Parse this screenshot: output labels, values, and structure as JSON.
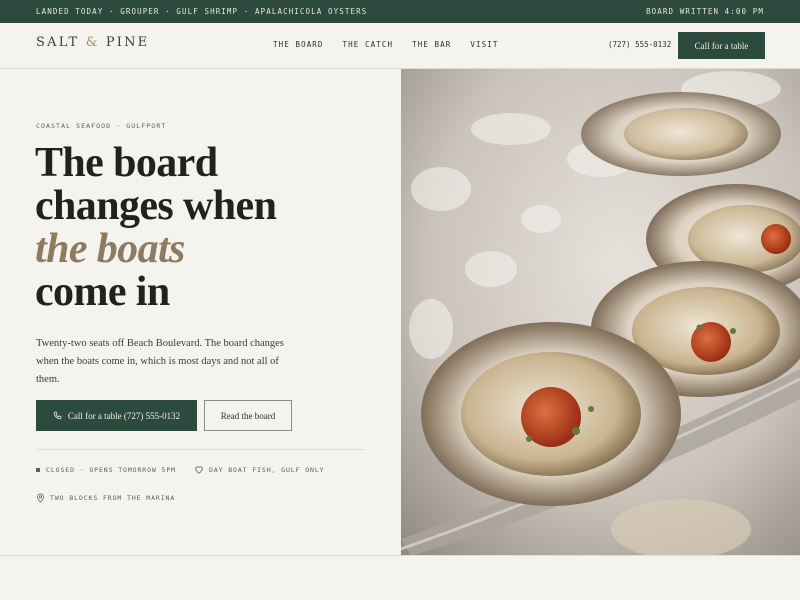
{
  "ticker": {
    "left": "LANDED TODAY · GROUPER · GULF SHRIMP · APALACHICOLA OYSTERS",
    "right": "BOARD WRITTEN 4:00 PM"
  },
  "brand": {
    "name": "SALT",
    "amp": "&",
    "name2": "PINE"
  },
  "nav": {
    "items": [
      {
        "label": "THE BOARD"
      },
      {
        "label": "THE CATCH"
      },
      {
        "label": "THE BAR"
      },
      {
        "label": "VISIT"
      }
    ],
    "phone": "(727) 555-0132",
    "cta": "Call for a table"
  },
  "hero": {
    "eyebrow": "COASTAL SEAFOOD · GULFPORT",
    "headline": {
      "line1": "The board",
      "line2": "changes when",
      "line3": "the boats",
      "line4": "come in"
    },
    "blurb": "Twenty-two seats off Beach Boulevard. The board changes when the boats come in, which is most days and not all of them.",
    "primary_button": "Call for a table (727) 555-0132",
    "secondary_button": "Read the board",
    "status": "CLOSED · OPENS TOMORROW 5PM",
    "fish_note": "DAY BOAT FISH, GULF ONLY",
    "location": "TWO BLOCKS FROM THE MARINA"
  },
  "icons": {
    "phone": "phone-icon",
    "heart": "heart-icon",
    "pin": "map-pin-icon"
  },
  "colors": {
    "brand_green": "#2d4a3e",
    "accent_tan": "#8e7a5f",
    "background": "#f5f3ee"
  }
}
